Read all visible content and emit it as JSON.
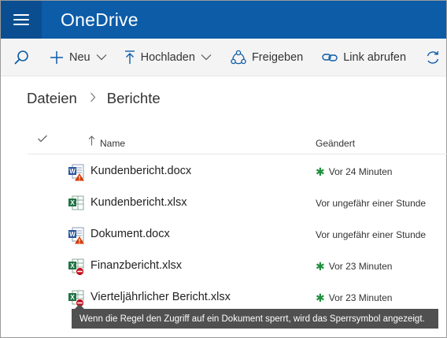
{
  "app": {
    "title": "OneDrive"
  },
  "toolbar": {
    "new_label": "Neu",
    "upload_label": "Hochladen",
    "share_label": "Freigeben",
    "link_label": "Link abrufen"
  },
  "breadcrumb": {
    "root": "Dateien",
    "current": "Berichte"
  },
  "list": {
    "col_name": "Name",
    "col_modified": "Geändert",
    "rows": [
      {
        "name": "Kundenbericht.docx",
        "modified": "Vor 24 Minuten",
        "type": "word",
        "status": "warning-icon",
        "new": true
      },
      {
        "name": "Kundenbericht.xlsx",
        "modified": "Vor ungefähr einer Stunde",
        "type": "excel",
        "status": "",
        "new": false
      },
      {
        "name": "Dokument.docx",
        "modified": "Vor ungefähr einer Stunde",
        "type": "word",
        "status": "warning-icon",
        "new": false
      },
      {
        "name": "Finanzbericht.xlsx",
        "modified": "Vor 23 Minuten",
        "type": "excel",
        "status": "blocked-icon",
        "new": true
      },
      {
        "name": "Vierteljährlicher Bericht.xlsx",
        "modified": "Vor 23 Minuten",
        "type": "excel",
        "status": "blocked-icon",
        "new": true
      }
    ]
  },
  "tooltip": {
    "text": "Wenn die Regel den Zugriff auf ein Dokument sperrt, wird das Sperrsymbol angezeigt."
  },
  "colors": {
    "brand": "#0c5ca8",
    "new_star": "#1e8f3c",
    "warning": "#d83b01",
    "blocked": "#c50f1f"
  }
}
